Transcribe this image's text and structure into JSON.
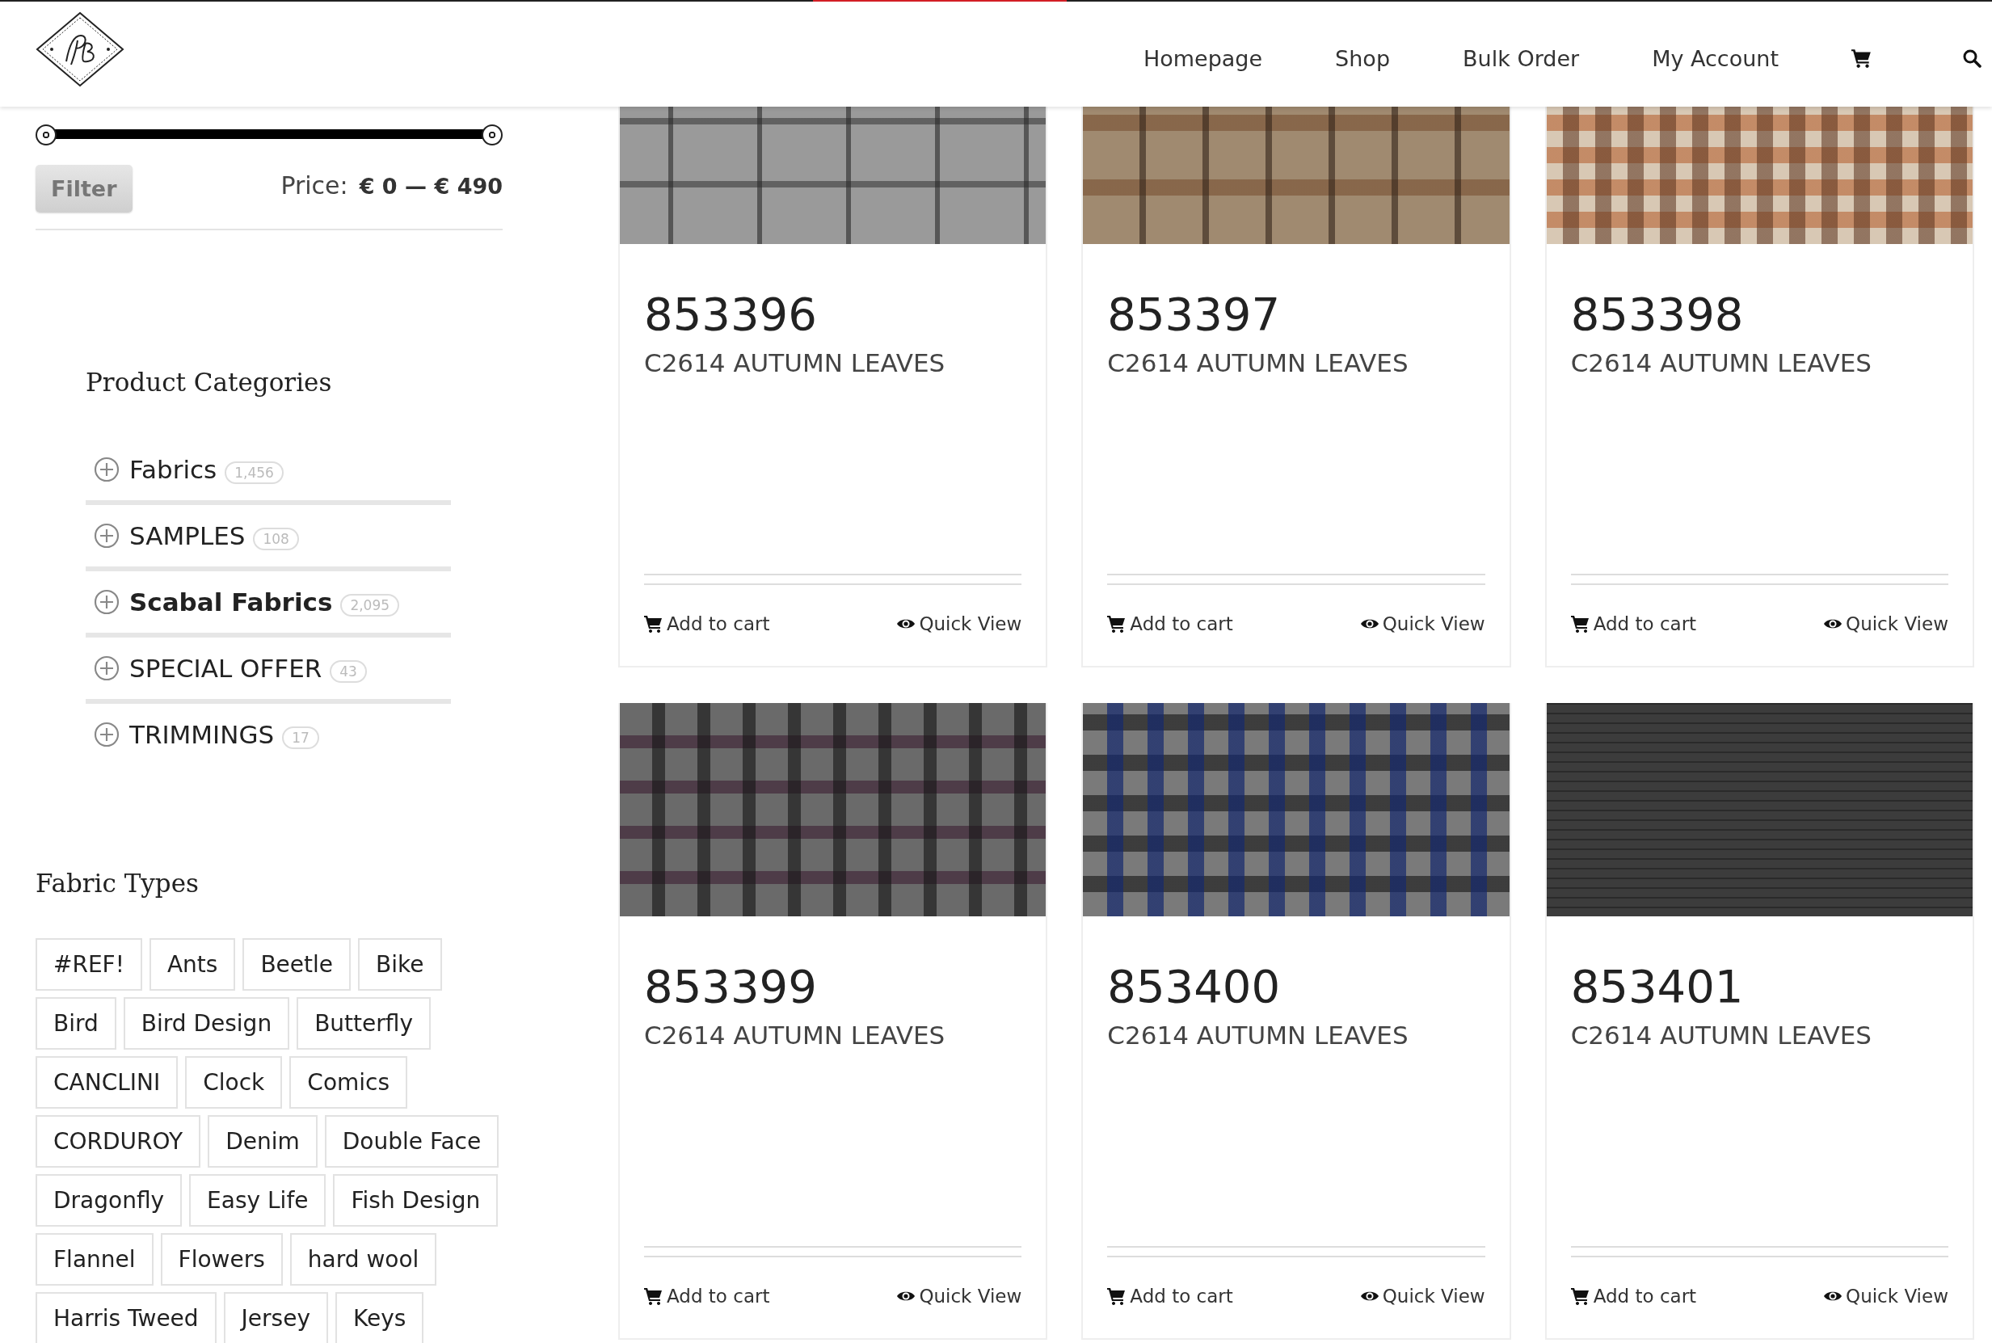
{
  "header": {
    "nav": [
      {
        "label": "Homepage"
      },
      {
        "label": "Shop"
      },
      {
        "label": "Bulk Order"
      },
      {
        "label": "My Account"
      }
    ]
  },
  "price_filter": {
    "thumbs": [
      {
        "level": 0
      },
      {
        "level": 1
      }
    ],
    "button": "Filter",
    "price_label": "Price:",
    "price_range": "€ 0 — € 490"
  },
  "product_categories": {
    "title": "Product Categories",
    "items": [
      {
        "label": "Fabrics",
        "count": "1,456",
        "selected": false,
        "expanded": false
      },
      {
        "label": "SAMPLES",
        "count": "108",
        "selected": false,
        "expanded": false
      },
      {
        "label": "Scabal Fabrics",
        "count": "2,095",
        "selected": true,
        "expanded": false
      },
      {
        "label": "SPECIAL OFFER",
        "count": "43",
        "selected": false,
        "expanded": false
      },
      {
        "label": "TRIMMINGS",
        "count": "17",
        "selected": false,
        "expanded": false
      }
    ]
  },
  "fabric_types": {
    "title": "Fabric Types",
    "tags": [
      "#REF!",
      "Ants",
      "Beetle",
      "Bike",
      "Bird",
      "Bird Design",
      "Butterfly",
      "CANCLINI",
      "Clock",
      "Comics",
      "CORDUROY",
      "Denim",
      "Double Face",
      "Dragonfly",
      "Easy Life",
      "Fish Design",
      "Flannel",
      "Flowers",
      "hard wool",
      "Harris Tweed",
      "Jersey",
      "Keys"
    ]
  },
  "products": [
    {
      "number": "853396",
      "name": "C2614 AUTUMN LEAVES",
      "add_to_cart": "Add to cart",
      "quick_view": "Quick View"
    },
    {
      "number": "853397",
      "name": "C2614 AUTUMN LEAVES",
      "add_to_cart": "Add to cart",
      "quick_view": "Quick View"
    },
    {
      "number": "853398",
      "name": "C2614 AUTUMN LEAVES",
      "add_to_cart": "Add to cart",
      "quick_view": "Quick View"
    },
    {
      "number": "853399",
      "name": "C2614 AUTUMN LEAVES",
      "add_to_cart": "Add to cart",
      "quick_view": "Quick View"
    },
    {
      "number": "853400",
      "name": "C2614 AUTUMN LEAVES",
      "add_to_cart": "Add to cart",
      "quick_view": "Quick View"
    },
    {
      "number": "853401",
      "name": "C2614 AUTUMN LEAVES",
      "add_to_cart": "Add to cart",
      "quick_view": "Quick View"
    }
  ]
}
